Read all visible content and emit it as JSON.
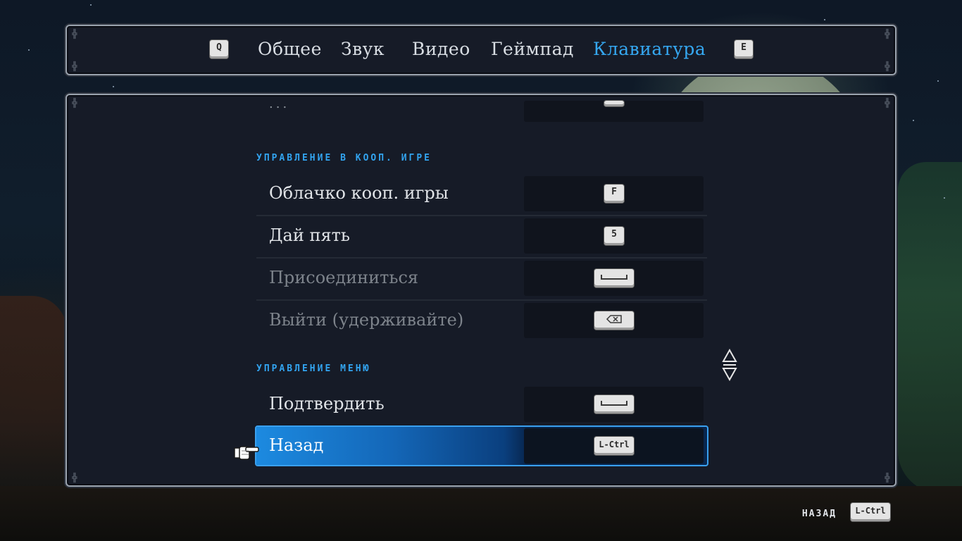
{
  "tabs": {
    "prev_key": "Q",
    "next_key": "E",
    "items": [
      {
        "label": "Общее"
      },
      {
        "label": "Звук"
      },
      {
        "label": "Видео"
      },
      {
        "label": "Геймпад"
      },
      {
        "label": "Клавиатура"
      }
    ],
    "active_index": 4
  },
  "content": {
    "truncated_row_label": "...",
    "sections": [
      {
        "title": "УПРАВЛЕНИЕ В КООП. ИГРЕ",
        "rows": [
          {
            "label": "Облачко кооп. игры",
            "key": "F",
            "key_icon": "f-key",
            "state": "enabled"
          },
          {
            "label": "Дай пять",
            "key": "5",
            "key_icon": "5-key",
            "state": "enabled"
          },
          {
            "label": "Присоединиться",
            "key": "",
            "key_icon": "space-key",
            "state": "disabled"
          },
          {
            "label": "Выйти (удерживайте)",
            "key": "",
            "key_icon": "backspace-key",
            "state": "disabled"
          }
        ]
      },
      {
        "title": "УПРАВЛЕНИЕ МЕНЮ",
        "rows": [
          {
            "label": "Подтвердить",
            "key": "",
            "key_icon": "space-key",
            "state": "enabled"
          },
          {
            "label": "Назад",
            "key": "L-Ctrl",
            "key_icon": "lctrl-key",
            "state": "selected"
          }
        ]
      }
    ]
  },
  "footer": {
    "back_label": "НАЗАД",
    "back_key": "L-Ctrl"
  },
  "colors": {
    "accent": "#35a8f2",
    "panel_bg": "#161b27",
    "panel_border": "#9aa3ae",
    "selected_row": "#1467b8"
  }
}
